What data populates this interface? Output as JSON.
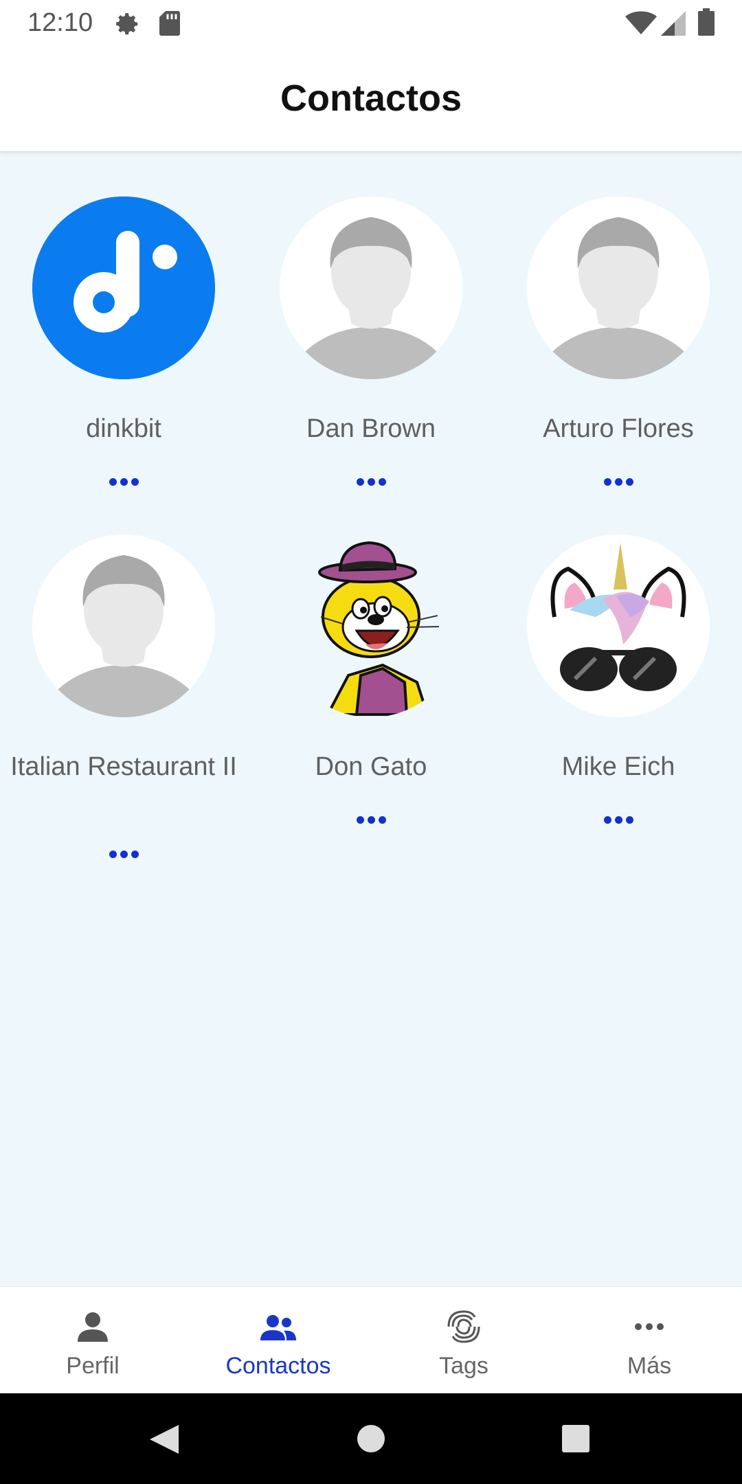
{
  "status_bar": {
    "time": "12:10",
    "icons": [
      "gear-icon",
      "sd-card-icon",
      "wifi-icon",
      "signal-icon",
      "battery-icon"
    ]
  },
  "header": {
    "title": "Contactos"
  },
  "contacts": [
    {
      "name": "dinkbit",
      "avatar": "dinkbit-logo",
      "more": "more-options-icon"
    },
    {
      "name": "Dan Brown",
      "avatar": "default-person",
      "more": "more-options-icon"
    },
    {
      "name": "Arturo Flores",
      "avatar": "default-person",
      "more": "more-options-icon"
    },
    {
      "name": "Italian Restaurant II",
      "avatar": "default-person",
      "more": "more-options-icon"
    },
    {
      "name": "Don Gato",
      "avatar": "cartoon-cat",
      "more": "more-options-icon"
    },
    {
      "name": "Mike Eich",
      "avatar": "unicorn-sunglasses",
      "more": "more-options-icon"
    }
  ],
  "bottom_nav": {
    "items": [
      {
        "label": "Perfil",
        "icon": "person-icon",
        "active": false
      },
      {
        "label": "Contactos",
        "icon": "people-icon",
        "active": true
      },
      {
        "label": "Tags",
        "icon": "link-icon",
        "active": false
      },
      {
        "label": "Más",
        "icon": "more-horizontal-icon",
        "active": false
      }
    ]
  },
  "colors": {
    "accent": "#1a36c8",
    "background": "#eef8fc",
    "dinkbit_blue": "#0a7cef"
  }
}
